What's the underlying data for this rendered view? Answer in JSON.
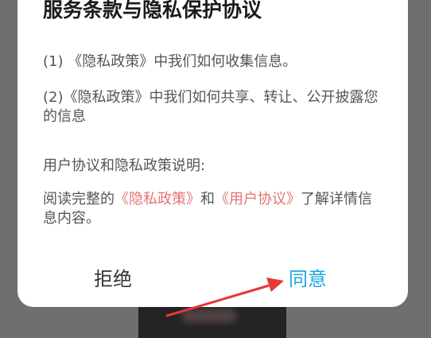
{
  "dialog": {
    "title": "服务条款与隐私保护协议",
    "item1": "(1) 《隐私政策》中我们如何收集信息。",
    "item2": "(2)《隐私政策》中我们如何共享、转让、公开披露您的信息",
    "section_heading": "用户协议和隐私政策说明:",
    "read_prefix": "阅读完整的",
    "privacy_link": "《隐私政策》",
    "and_text": "和",
    "user_agreement_link": "《用户协议》",
    "read_suffix": "了解详情信息内容。",
    "reject_label": "拒绝",
    "agree_label": "同意"
  },
  "colors": {
    "link": "#e57373",
    "agree": "#1aa7e6",
    "arrow": "#e53935",
    "overlay": "#6f6f6f"
  },
  "annotation": {
    "icon": "red-arrow-icon",
    "points_to": "agree-button"
  }
}
